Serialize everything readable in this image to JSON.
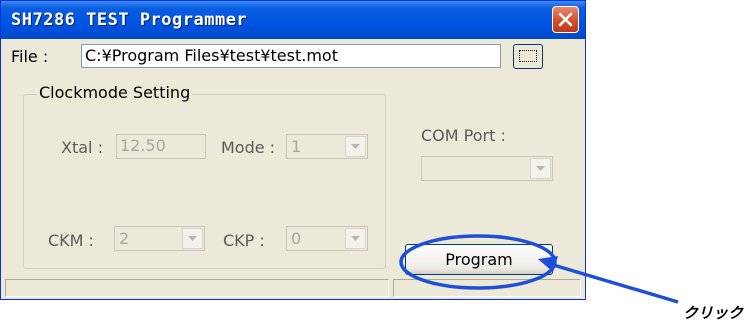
{
  "window": {
    "title": "SH7286 TEST Programmer"
  },
  "file": {
    "label": "File :",
    "value": "C:¥Program Files¥test¥test.mot"
  },
  "clockmode": {
    "group_title": "Clockmode Setting",
    "xtal_label": "Xtal :",
    "xtal_value": "12.50",
    "mode_label": "Mode :",
    "mode_value": "1",
    "ckm_label": "CKM :",
    "ckm_value": "2",
    "ckp_label": "CKP :",
    "ckp_value": "0"
  },
  "com": {
    "label": "COM Port :",
    "value": ""
  },
  "program_button": "Program",
  "annotation": {
    "text": "クリック",
    "color": "#1f4fd8"
  },
  "icons": {
    "close": "close-icon",
    "browse": "ellipsis-icon",
    "dropdown": "chevron-down-icon"
  }
}
